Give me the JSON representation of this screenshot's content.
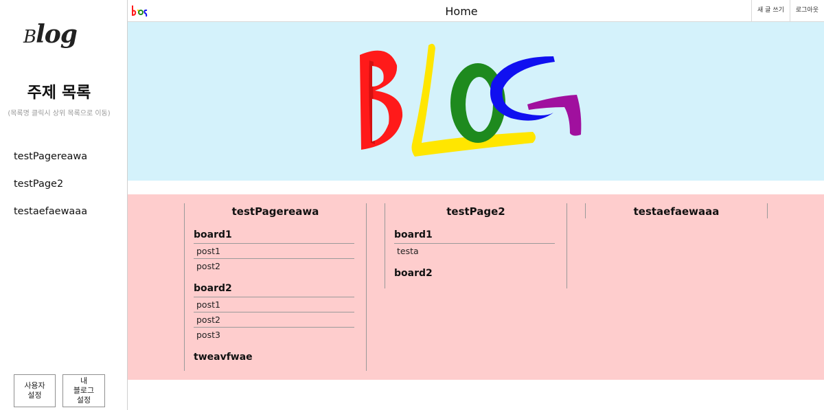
{
  "sidebar": {
    "logo_small": "B",
    "logo_big": "log",
    "title": "주제 목록",
    "hint": "(목록명 클릭시 상위 목록으로 이동)",
    "topics": [
      "testPagereawa",
      "testPage2",
      "testaefaewaaa"
    ],
    "user_settings_label": "사용자\n설정",
    "blog_settings_label": "내\n블로그\n설정"
  },
  "header": {
    "logo_text": "blog",
    "title": "Home",
    "write_label": "새 글 쓰기",
    "logout_label": "로그아웃"
  },
  "banner": {
    "logo_text": "BLOG",
    "colors": {
      "B": "#ff1a1a",
      "L": "#ffe600",
      "O": "#1e8a1e",
      "G_blue": "#1010f0",
      "G_purple": "#a0109e"
    }
  },
  "columns": [
    {
      "title": "testPagereawa",
      "boards": [
        {
          "name": "board1",
          "posts": [
            "post1",
            "post2"
          ]
        },
        {
          "name": "board2",
          "posts": [
            "post1",
            "post2",
            "post3"
          ]
        },
        {
          "name": "tweavfwae",
          "posts": []
        }
      ]
    },
    {
      "title": "testPage2",
      "boards": [
        {
          "name": "board1",
          "posts": [
            "testa"
          ]
        },
        {
          "name": "board2",
          "posts": []
        }
      ]
    },
    {
      "title": "testaefaewaaa",
      "boards": []
    }
  ],
  "colors": {
    "banner_bg": "#d4f2fb",
    "content_bg": "#fecdcd"
  }
}
